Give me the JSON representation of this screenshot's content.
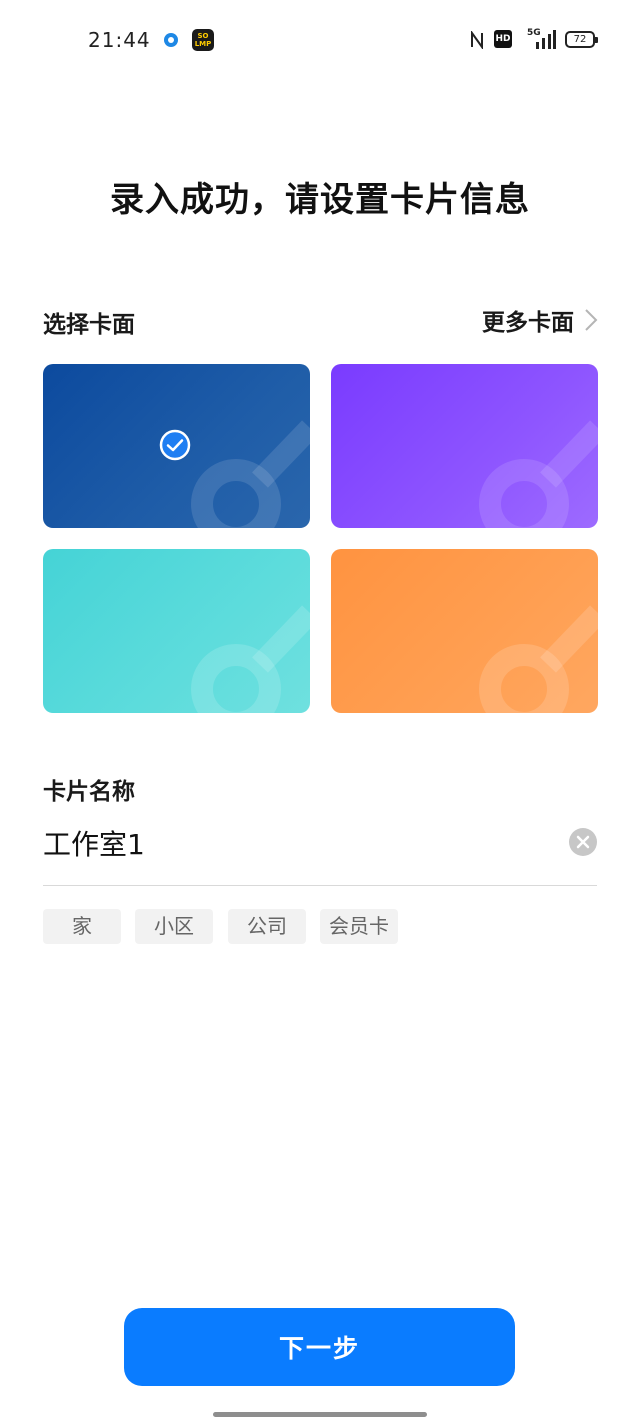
{
  "status_bar": {
    "time": "21:44",
    "app_badge": "SO\nLMP",
    "hd": "HD",
    "network": "5G",
    "battery": "72",
    "icons": [
      "location-dot-icon",
      "nfc-icon",
      "hd-icon",
      "signal-icon",
      "battery-icon"
    ]
  },
  "title": "录入成功，请设置卡片信息",
  "card_section": {
    "label": "选择卡面",
    "more_label": "更多卡面",
    "cards": [
      {
        "color": "#1f5da8",
        "selected": true
      },
      {
        "color": "#8e55ff",
        "selected": false
      },
      {
        "color": "#5ddcdc",
        "selected": false
      },
      {
        "color": "#ff9f52",
        "selected": false
      }
    ]
  },
  "name_section": {
    "label": "卡片名称",
    "value": "工作室1",
    "chips": [
      "家",
      "小区",
      "公司",
      "会员卡"
    ]
  },
  "next_button": "下一步",
  "colors": {
    "accent": "#0a7cff"
  }
}
